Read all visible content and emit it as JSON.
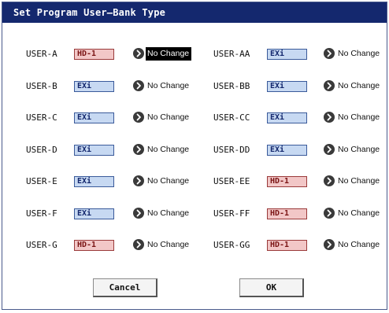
{
  "dialog": {
    "title": "Set Program User–Bank Type"
  },
  "banks": [
    {
      "left": {
        "label": "USER-A",
        "type": "HD-1",
        "change": "No Change",
        "selected": true
      },
      "right": {
        "label": "USER-AA",
        "type": "EXi",
        "change": "No Change",
        "selected": false
      }
    },
    {
      "left": {
        "label": "USER-B",
        "type": "EXi",
        "change": "No Change",
        "selected": false
      },
      "right": {
        "label": "USER-BB",
        "type": "EXi",
        "change": "No Change",
        "selected": false
      }
    },
    {
      "left": {
        "label": "USER-C",
        "type": "EXi",
        "change": "No Change",
        "selected": false
      },
      "right": {
        "label": "USER-CC",
        "type": "EXi",
        "change": "No Change",
        "selected": false
      }
    },
    {
      "left": {
        "label": "USER-D",
        "type": "EXi",
        "change": "No Change",
        "selected": false
      },
      "right": {
        "label": "USER-DD",
        "type": "EXi",
        "change": "No Change",
        "selected": false
      }
    },
    {
      "left": {
        "label": "USER-E",
        "type": "EXi",
        "change": "No Change",
        "selected": false
      },
      "right": {
        "label": "USER-EE",
        "type": "HD-1",
        "change": "No Change",
        "selected": false
      }
    },
    {
      "left": {
        "label": "USER-F",
        "type": "EXi",
        "change": "No Change",
        "selected": false
      },
      "right": {
        "label": "USER-FF",
        "type": "HD-1",
        "change": "No Change",
        "selected": false
      }
    },
    {
      "left": {
        "label": "USER-G",
        "type": "HD-1",
        "change": "No Change",
        "selected": false
      },
      "right": {
        "label": "USER-GG",
        "type": "HD-1",
        "change": "No Change",
        "selected": false
      }
    }
  ],
  "buttons": {
    "cancel": "Cancel",
    "ok": "OK"
  },
  "colors": {
    "title_bar": "#14286e",
    "hd1_fill": "#f2c7c7",
    "exi_fill": "#c7d9f2",
    "selection": "#000000"
  },
  "icons": {
    "change_arrow": "chevron-right-circle-icon"
  }
}
